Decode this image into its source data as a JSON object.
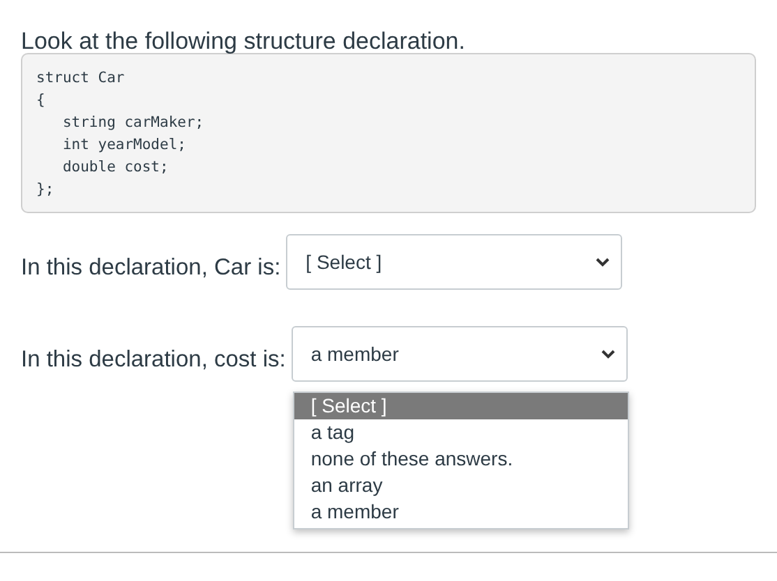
{
  "prompt": "Look at the following structure declaration.",
  "code": [
    "struct Car",
    "{",
    "   string carMaker;",
    "   int yearModel;",
    "   double cost;",
    "};"
  ],
  "questions": [
    {
      "label": "In this declaration, Car is:",
      "value": "[ Select ]"
    },
    {
      "label": "In this declaration, cost is:",
      "value": "a member",
      "options": [
        {
          "label": "[ Select ]",
          "highlighted": true
        },
        {
          "label": "a tag",
          "highlighted": false
        },
        {
          "label": "none of these answers.",
          "highlighted": false
        },
        {
          "label": "an array",
          "highlighted": false
        },
        {
          "label": "a member",
          "highlighted": false
        }
      ]
    }
  ]
}
